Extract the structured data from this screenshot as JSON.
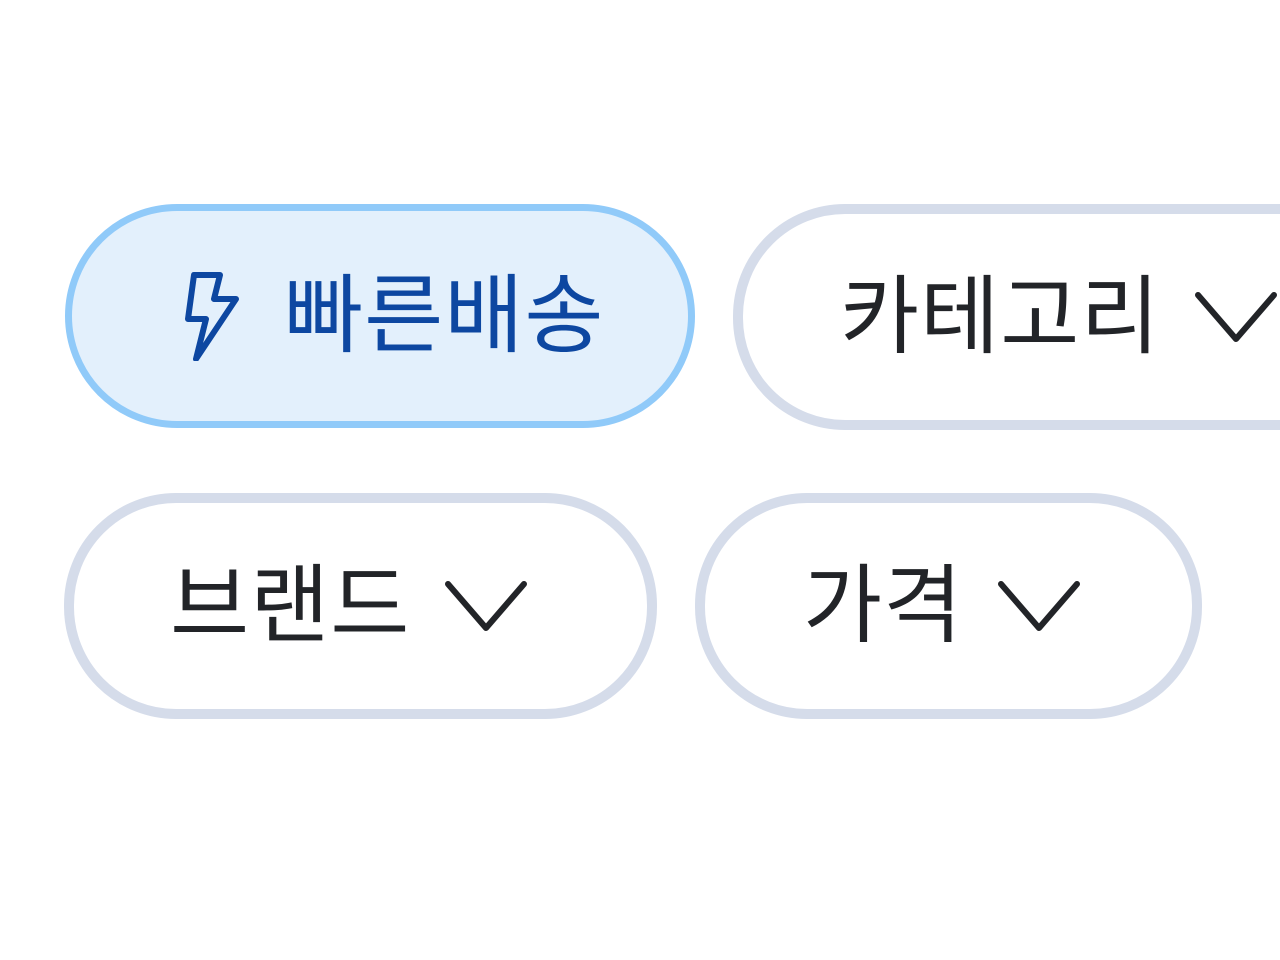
{
  "filters": [
    {
      "id": "fast-delivery",
      "label": "빠른배송",
      "icon": "lightning-bolt-icon",
      "selected": true,
      "has_dropdown": false
    },
    {
      "id": "category",
      "label": "카테고리",
      "icon": "chevron-down-icon",
      "selected": false,
      "has_dropdown": true
    },
    {
      "id": "brand",
      "label": "브랜드",
      "icon": "chevron-down-icon",
      "selected": false,
      "has_dropdown": true
    },
    {
      "id": "price",
      "label": "가격",
      "icon": "chevron-down-icon",
      "selected": false,
      "has_dropdown": true
    }
  ],
  "colors": {
    "active_background": "#e3f0fc",
    "active_border": "#90caf9",
    "active_text": "#0d47a1",
    "inactive_border": "#d5dcea",
    "inactive_text": "#222428",
    "page_background": "#ffffff"
  }
}
